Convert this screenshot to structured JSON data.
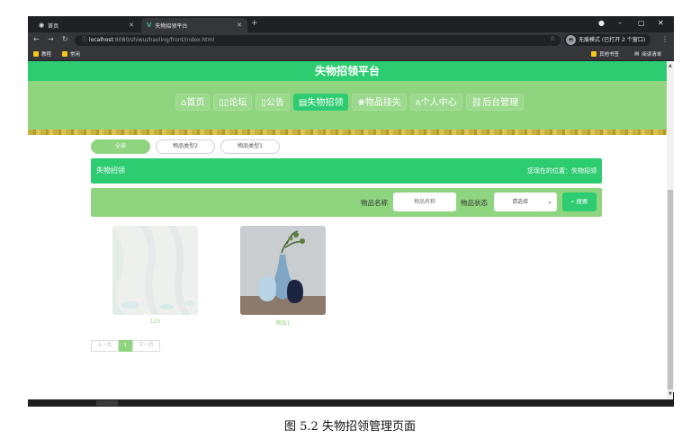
{
  "browser": {
    "tabs": [
      {
        "label": "首页",
        "icon": "globe-icon"
      },
      {
        "label": "失物招领平台",
        "icon": "vue-logo-icon"
      }
    ],
    "url_host": "localhost",
    "url_rest": ":8080/shiwuzhaoling/front/index.html",
    "profile_label": "无痕模式 (已打开 2 个窗口)",
    "bookmarks": [
      "教程",
      "常用"
    ],
    "bookmarks_right": [
      "其他书签",
      "阅读清单"
    ]
  },
  "site": {
    "title": "失物招领平台",
    "nav": [
      {
        "label": "⌂首页"
      },
      {
        "label": "▯▯论坛"
      },
      {
        "label": "▯公告"
      },
      {
        "label": "▤失物招领",
        "active": true
      },
      {
        "label": "❀物品挂失"
      },
      {
        "label": "ጸ个人中心"
      },
      {
        "label": "⛓后台管理"
      }
    ]
  },
  "categories": [
    {
      "label": "全部",
      "active": true
    },
    {
      "label": "物品类型2"
    },
    {
      "label": "物品类型1"
    }
  ],
  "location": {
    "title": "失物招领",
    "path": "您现在的位置：失物招领"
  },
  "search": {
    "name_label": "物品名称",
    "name_placeholder": "物品名称",
    "status_label": "物品状态",
    "status_selected": "请选择",
    "button_label": "搜索"
  },
  "items": [
    {
      "caption": "123"
    },
    {
      "caption": "物品1"
    }
  ],
  "pagination": {
    "prev": "上一页",
    "current": "1",
    "next": "下一页"
  },
  "caption": "图 5.2  失物招领管理页面",
  "colors": {
    "primary_green": "#2ecc71",
    "light_green": "#8fd47f"
  }
}
